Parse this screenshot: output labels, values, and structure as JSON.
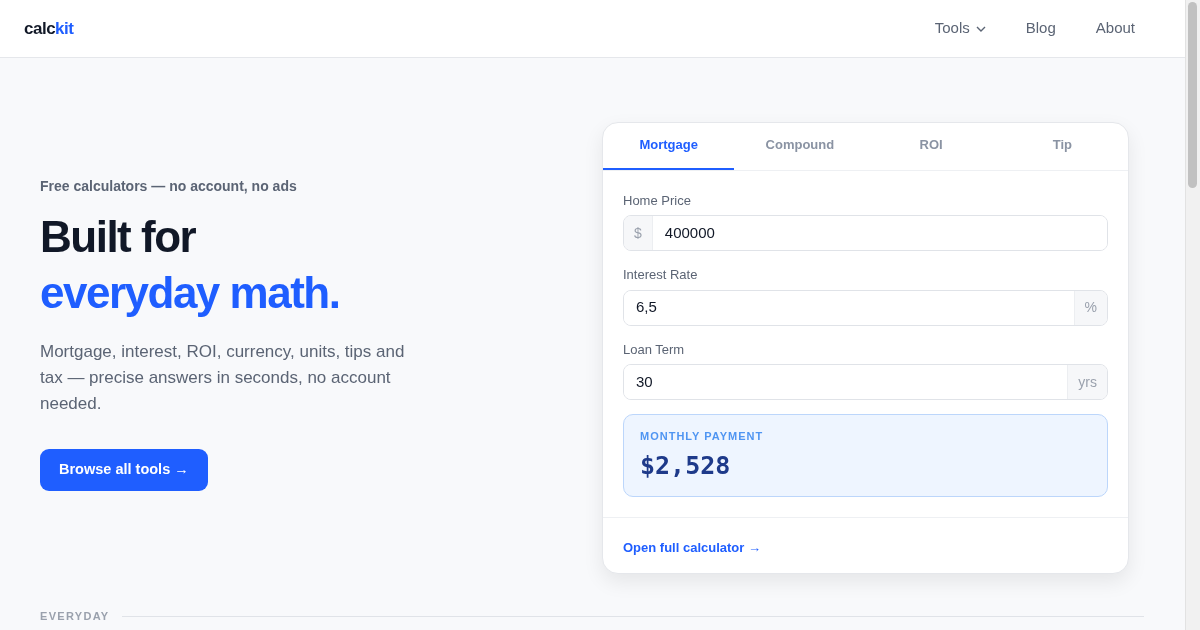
{
  "brand": {
    "prefix": "calc",
    "suffix": "kit"
  },
  "nav": [
    {
      "label": "Tools",
      "kind": "dropdown"
    },
    {
      "label": "Blog",
      "kind": "link"
    },
    {
      "label": "About",
      "kind": "link"
    }
  ],
  "hero": {
    "eyebrow": "Free calculators — no account, no ads",
    "headline": "Built for",
    "headline_accent": "everyday math.",
    "lead": "Mortgage, interest, ROI, currency, units, tips and tax — precise answers in seconds, no account needed.",
    "button": "Browse all tools →"
  },
  "calculator": {
    "tabs": [
      {
        "label": "Mortgage",
        "selected": true
      },
      {
        "label": "Compound",
        "selected": false
      },
      {
        "label": "ROI",
        "selected": false
      },
      {
        "label": "Tip",
        "selected": false
      }
    ],
    "fields": [
      {
        "label": "Home Price",
        "value": "400000",
        "prefix": "$"
      },
      {
        "label": "Interest Rate",
        "value": "6,5",
        "suffix": "%"
      },
      {
        "label": "Loan Term",
        "value": "30",
        "suffix": "yrs"
      }
    ],
    "result": {
      "label": "MONTHLY PAYMENT",
      "value": "$2,528"
    },
    "footer_link": "Open full calculator →"
  },
  "section_label": "EVERYDAY"
}
